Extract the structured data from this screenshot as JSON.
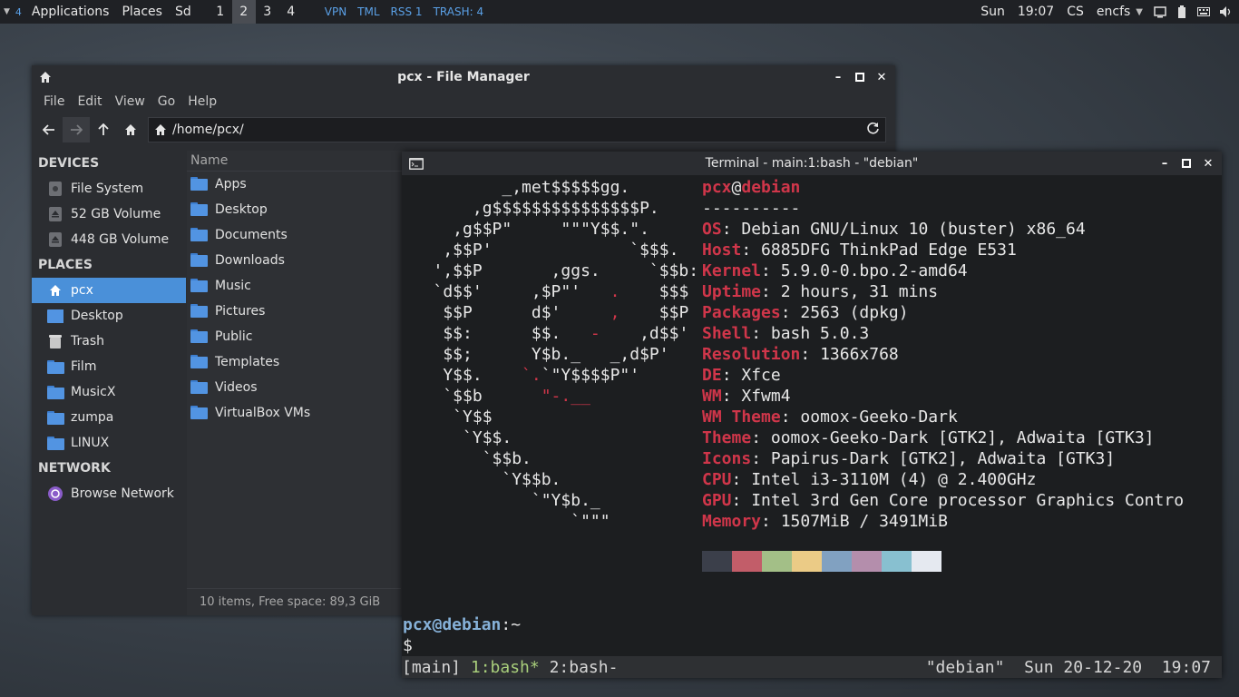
{
  "panel": {
    "menu_count": "4",
    "applications": "Applications",
    "places": "Places",
    "sd": "Sd",
    "workspaces": [
      "1",
      "2",
      "3",
      "4"
    ],
    "active_workspace": "2",
    "vpn": "VPN",
    "tml": "TML",
    "rss": "RSS 1",
    "trash": "TRASH: 4",
    "day": "Sun",
    "time": "19:07",
    "layout": "CS",
    "encfs": "encfs"
  },
  "file_manager": {
    "title": "pcx - File Manager",
    "menu": [
      "File",
      "Edit",
      "View",
      "Go",
      "Help"
    ],
    "location": "/home/pcx/",
    "sidebar": {
      "devices_header": "DEVICES",
      "devices": [
        "File System",
        "52 GB Volume",
        "448 GB Volume"
      ],
      "places_header": "PLACES",
      "places": [
        "pcx",
        "Desktop",
        "Trash",
        "Film",
        "MusicX",
        "zumpa",
        "LINUX"
      ],
      "network_header": "NETWORK",
      "network": [
        "Browse Network"
      ]
    },
    "column_name": "Name",
    "files": [
      "Apps",
      "Desktop",
      "Documents",
      "Downloads",
      "Music",
      "Pictures",
      "Public",
      "Templates",
      "Videos",
      "VirtualBox VMs"
    ],
    "status": "10 items, Free space: 89,3 GiB"
  },
  "terminal": {
    "title": "Terminal - main:1:bash - \"debian\"",
    "user": "pcx",
    "at": "@",
    "host": "debian",
    "separator": "----------",
    "info": [
      {
        "key": "OS",
        "value": "Debian GNU/Linux 10 (buster) x86_64"
      },
      {
        "key": "Host",
        "value": "6885DFG ThinkPad Edge E531"
      },
      {
        "key": "Kernel",
        "value": "5.9.0-0.bpo.2-amd64"
      },
      {
        "key": "Uptime",
        "value": "2 hours, 31 mins"
      },
      {
        "key": "Packages",
        "value": "2563 (dpkg)"
      },
      {
        "key": "Shell",
        "value": "bash 5.0.3"
      },
      {
        "key": "Resolution",
        "value": "1366x768"
      },
      {
        "key": "DE",
        "value": "Xfce"
      },
      {
        "key": "WM",
        "value": "Xfwm4"
      },
      {
        "key": "WM Theme",
        "value": "oomox-Geeko-Dark"
      },
      {
        "key": "Theme",
        "value": "oomox-Geeko-Dark [GTK2], Adwaita [GTK3]"
      },
      {
        "key": "Icons",
        "value": "Papirus-Dark [GTK2], Adwaita [GTK3]"
      },
      {
        "key": "CPU",
        "value": "Intel i3-3110M (4) @ 2.400GHz"
      },
      {
        "key": "GPU",
        "value": "Intel 3rd Gen Core processor Graphics Contro"
      },
      {
        "key": "Memory",
        "value": "1507MiB / 3491MiB"
      }
    ],
    "palette": [
      "#3b3f4a",
      "#c25d69",
      "#a3bf87",
      "#ebcb86",
      "#81a1c1",
      "#b48eac",
      "#88c0d0",
      "#e5e9f0"
    ],
    "prompt_user_host": "pcx@debian",
    "prompt_path": ":~",
    "prompt_symbol": "$",
    "tmux": {
      "session": "[main]",
      "win1": "1:bash*",
      "win2": "2:bash-",
      "right": "\"debian\"  Sun 20-12-20  19:07"
    }
  }
}
